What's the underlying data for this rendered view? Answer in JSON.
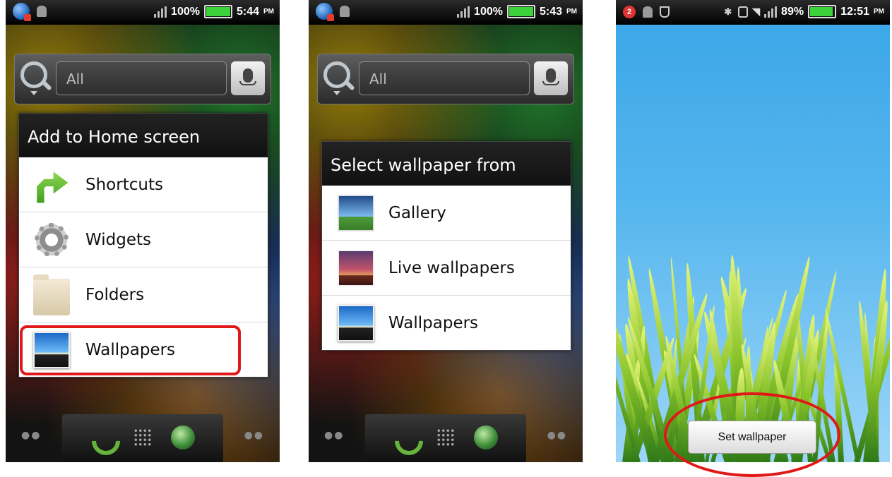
{
  "phone1": {
    "status": {
      "battery": "100%",
      "time": "5:44",
      "ampm": "PM"
    },
    "search": {
      "placeholder": "All"
    },
    "dialog": {
      "title": "Add to Home screen",
      "items": [
        "Shortcuts",
        "Widgets",
        "Folders",
        "Wallpapers"
      ]
    }
  },
  "phone2": {
    "status": {
      "battery": "100%",
      "time": "5:43",
      "ampm": "PM"
    },
    "search": {
      "placeholder": "All"
    },
    "dialog": {
      "title": "Select wallpaper from",
      "items": [
        "Gallery",
        "Live wallpapers",
        "Wallpapers"
      ]
    }
  },
  "phone3": {
    "status": {
      "notifications": "2",
      "battery": "89%",
      "time": "12:51",
      "ampm": "PM"
    },
    "set_wallpaper_label": "Set wallpaper"
  },
  "icons": {
    "shortcuts": "arrow-icon",
    "widgets": "gear-icon",
    "folders": "folder-icon",
    "wallpapers": "wallpaper-icon",
    "gallery": "gallery-icon",
    "live_wallpapers": "live-wallpaper-icon"
  },
  "colors": {
    "highlight": "#e01818",
    "sky": "#39a5e7",
    "grass": "#88c32a"
  }
}
